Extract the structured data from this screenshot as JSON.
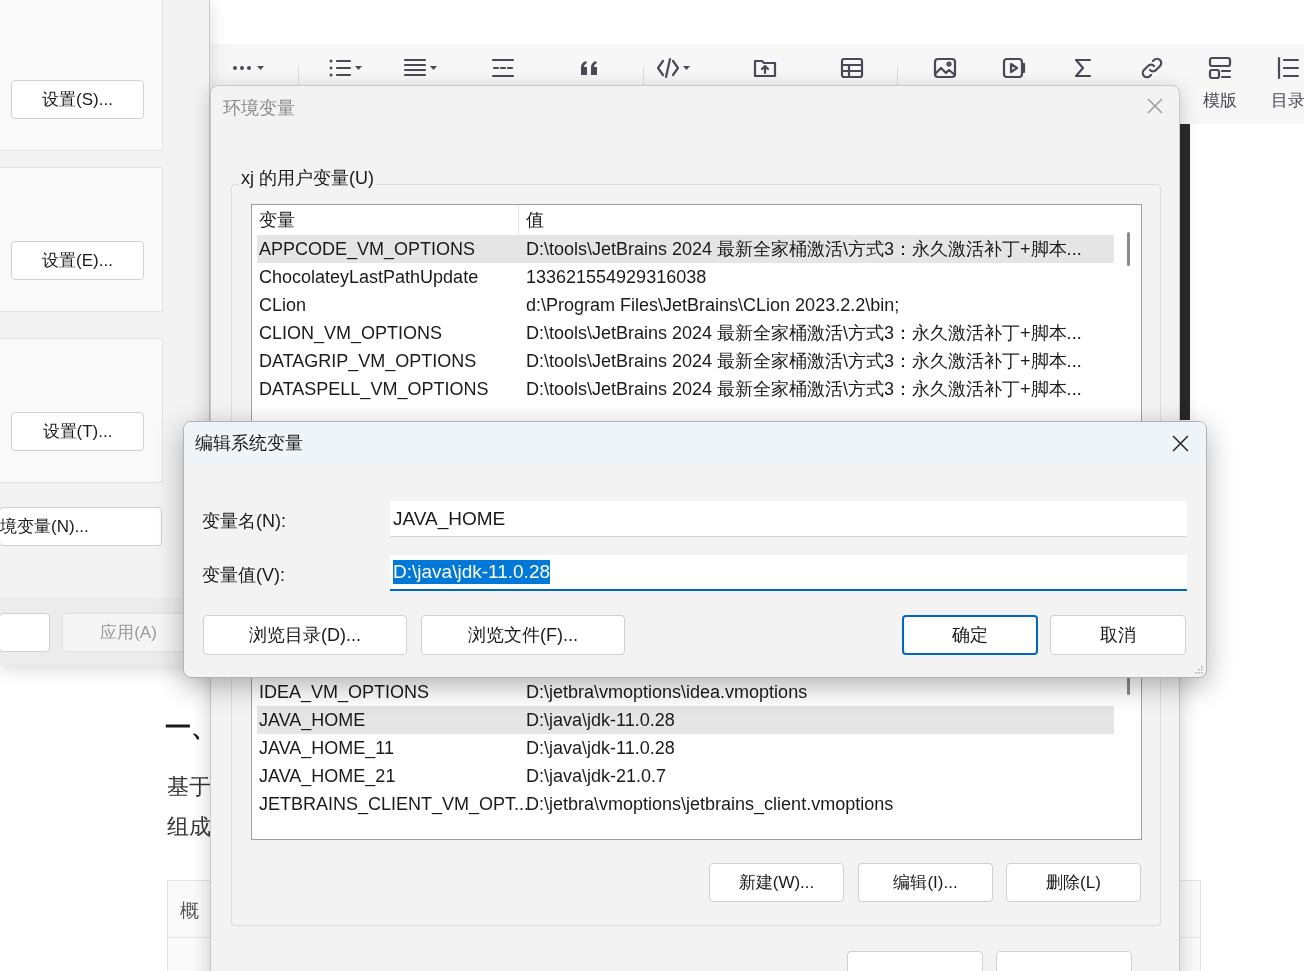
{
  "editor": {
    "toolbar": [
      {
        "kind": "more",
        "caret": true
      },
      {
        "kind": "bullets",
        "caret": true
      },
      {
        "kind": "align",
        "caret": true
      },
      {
        "kind": "indent",
        "caret": false
      },
      {
        "kind": "quote",
        "caret": false
      },
      {
        "kind": "code",
        "caret": true
      },
      {
        "kind": "upload",
        "caret": false
      },
      {
        "kind": "table",
        "caret": false
      },
      {
        "kind": "image",
        "caret": false
      },
      {
        "kind": "video",
        "caret": false
      },
      {
        "kind": "sigma",
        "caret": false
      },
      {
        "kind": "link",
        "caret": false
      },
      {
        "kind": "template",
        "label": "模版"
      },
      {
        "kind": "toc",
        "label": "目录"
      }
    ],
    "heading": "一、",
    "lines": [
      "基于",
      "组成"
    ],
    "table_cell": "概"
  },
  "system_properties": {
    "buttons": [
      "设置(S)...",
      "设置(E)...",
      "设置(T)..."
    ],
    "env_button": "境变量(N)...",
    "apply_button": {
      "label": "应用(A)",
      "disabled": true
    }
  },
  "env_dialog": {
    "title": "环境变量",
    "group_label": "xj 的用户变量(U)",
    "columns": [
      "变量",
      "值"
    ],
    "rows_top": [
      {
        "name": "APPCODE_VM_OPTIONS",
        "value": "D:\\tools\\JetBrains 2024 最新全家桶激活\\方式3：永久激活补丁+脚本...",
        "selected": true
      },
      {
        "name": "ChocolateyLastPathUpdate",
        "value": "133621554929316038",
        "selected": false
      },
      {
        "name": "CLion",
        "value": "d:\\Program Files\\JetBrains\\CLion 2023.2.2\\bin;",
        "selected": false
      },
      {
        "name": "CLION_VM_OPTIONS",
        "value": "D:\\tools\\JetBrains 2024 最新全家桶激活\\方式3：永久激活补丁+脚本...",
        "selected": false
      },
      {
        "name": "DATAGRIP_VM_OPTIONS",
        "value": "D:\\tools\\JetBrains 2024 最新全家桶激活\\方式3：永久激活补丁+脚本...",
        "selected": false
      },
      {
        "name": "DATASPELL_VM_OPTIONS",
        "value": "D:\\tools\\JetBrains 2024 最新全家桶激活\\方式3：永久激活补丁+脚本...",
        "selected": false
      }
    ],
    "rows_bottom": [
      {
        "name": "IDEA_VM_OPTIONS",
        "value": "D:\\jetbra\\vmoptions\\idea.vmoptions",
        "selected": false
      },
      {
        "name": "JAVA_HOME",
        "value": "D:\\java\\jdk-11.0.28",
        "selected": true
      },
      {
        "name": "JAVA_HOME_11",
        "value": "D:\\java\\jdk-11.0.28",
        "selected": false
      },
      {
        "name": "JAVA_HOME_21",
        "value": "D:\\java\\jdk-21.0.7",
        "selected": false
      },
      {
        "name": "JETBRAINS_CLIENT_VM_OPT...",
        "value": "D:\\jetbra\\vmoptions\\jetbrains_client.vmoptions",
        "selected": false
      }
    ],
    "list_buttons": [
      "新建(W)...",
      "编辑(I)...",
      "删除(L)"
    ]
  },
  "edit_dialog": {
    "title": "编辑系统变量",
    "fields": [
      {
        "label": "变量名(N):",
        "value": "JAVA_HOME",
        "focused": false
      },
      {
        "label": "变量值(V):",
        "value": "D:\\java\\jdk-11.0.28",
        "focused": true
      }
    ],
    "buttons": [
      {
        "label": "浏览目录(D)...",
        "default": false
      },
      {
        "label": "浏览文件(F)...",
        "default": false
      },
      {
        "label": "确定",
        "default": true
      },
      {
        "label": "取消",
        "default": false
      }
    ]
  }
}
